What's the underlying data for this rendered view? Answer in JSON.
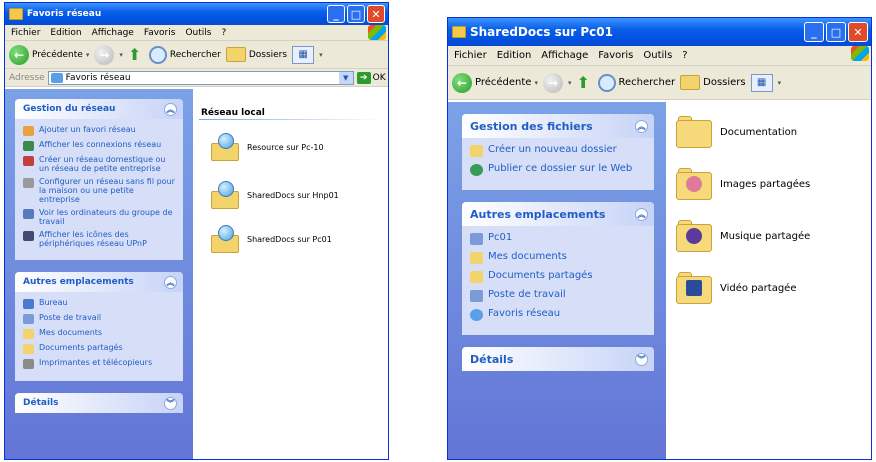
{
  "window1": {
    "title": "Favoris réseau",
    "menu": [
      "Fichier",
      "Edition",
      "Affichage",
      "Favoris",
      "Outils",
      "?"
    ],
    "toolbar": {
      "back_label": "Précédente",
      "search_label": "Rechercher",
      "folders_label": "Dossiers"
    },
    "address": {
      "label": "Adresse",
      "value": "Favoris réseau",
      "go_label": "OK"
    },
    "tasks_panel": {
      "title": "Gestion du réseau",
      "items": [
        "Ajouter un favori réseau",
        "Afficher les connexions réseau",
        "Créer un réseau domestique ou un réseau de petite entreprise",
        "Configurer un réseau sans fil pour la maison ou une petite entreprise",
        "Voir les ordinateurs du groupe de travail",
        "Afficher les icônes des périphériques réseau UPnP"
      ]
    },
    "places_panel": {
      "title": "Autres emplacements",
      "items": [
        "Bureau",
        "Poste de travail",
        "Mes documents",
        "Documents partagés",
        "Imprimantes et télécopieurs"
      ]
    },
    "details_panel": {
      "title": "Détails"
    },
    "content": {
      "group_header": "Réseau local",
      "items": [
        "Resource sur Pc-10",
        "SharedDocs sur Hnp01",
        "SharedDocs sur Pc01"
      ]
    }
  },
  "window2": {
    "title": "SharedDocs sur Pc01",
    "menu": [
      "Fichier",
      "Edition",
      "Affichage",
      "Favoris",
      "Outils",
      "?"
    ],
    "toolbar": {
      "back_label": "Précédente",
      "search_label": "Rechercher",
      "folders_label": "Dossiers"
    },
    "tasks_panel": {
      "title": "Gestion des fichiers",
      "items": [
        "Créer un nouveau dossier",
        "Publier ce dossier sur le Web"
      ]
    },
    "places_panel": {
      "title": "Autres emplacements",
      "items": [
        "Pc01",
        "Mes documents",
        "Documents partagés",
        "Poste de travail",
        "Favoris réseau"
      ]
    },
    "details_panel": {
      "title": "Détails"
    },
    "content": {
      "items": [
        "Documentation",
        "Images partagées",
        "Musique partagée",
        "Vidéo partagée"
      ]
    }
  },
  "colors": {
    "title_blue": "#0054e3",
    "task_blue": "#215dc6",
    "side_gradient": "#6375d6",
    "folder": "#f6d97a"
  }
}
